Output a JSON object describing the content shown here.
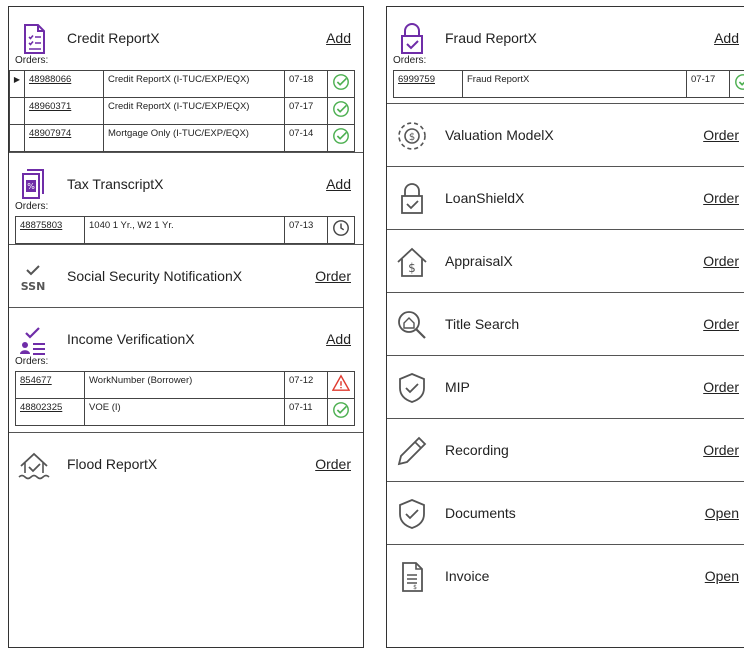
{
  "left": {
    "credit": {
      "title": "Credit ReportX",
      "action": "Add",
      "icon": "credit-report-icon",
      "orders_label": "Orders:",
      "orders": [
        {
          "id": "48988066",
          "desc": "Credit ReportX (I-TUC/EXP/EQX)",
          "date": "07-18",
          "status": "complete-check-icon",
          "selected": true
        },
        {
          "id": "48960371",
          "desc": "Credit ReportX (I-TUC/EXP/EQX)",
          "date": "07-17",
          "status": "complete-check-icon",
          "selected": false
        },
        {
          "id": "48907974",
          "desc": "Mortgage Only (I-TUC/EXP/EQX)",
          "date": "07-14",
          "status": "complete-check-icon",
          "selected": false
        }
      ]
    },
    "tax": {
      "title": "Tax TranscriptX",
      "action": "Add",
      "icon": "tax-transcript-icon",
      "orders_label": "Orders:",
      "orders": [
        {
          "id": "48875803",
          "desc": "1040 1 Yr., W2 1 Yr.",
          "date": "07-13",
          "status": "pending-clock-icon"
        }
      ]
    },
    "ssn": {
      "title": "Social Security NotificationX",
      "action": "Order",
      "icon_text": "SSN"
    },
    "income": {
      "title": "Income VerificationX",
      "action": "Add",
      "icon": "income-verification-icon",
      "orders_label": "Orders:",
      "orders": [
        {
          "id": "854677",
          "desc": "WorkNumber (Borrower)",
          "date": "07-12",
          "status": "warning-icon"
        },
        {
          "id": "48802325",
          "desc": "VOE (I)",
          "date": "07-11",
          "status": "complete-check-icon"
        }
      ]
    },
    "flood": {
      "title": "Flood ReportX",
      "action": "Order",
      "icon": "flood-report-icon"
    }
  },
  "right": {
    "fraud": {
      "title": "Fraud ReportX",
      "action": "Add",
      "icon": "fraud-report-icon",
      "orders_label": "Orders:",
      "orders": [
        {
          "id": "6999759",
          "desc": "Fraud ReportX",
          "date": "07-17",
          "status": "complete-check-icon"
        }
      ]
    },
    "valuation": {
      "title": "Valuation ModelX",
      "action": "Order",
      "icon": "valuation-model-icon"
    },
    "loanshield": {
      "title": "LoanShieldX",
      "action": "Order",
      "icon": "loanshield-icon"
    },
    "appraisal": {
      "title": "AppraisalX",
      "action": "Order",
      "icon": "appraisal-icon",
      "icon_text": "$"
    },
    "title": {
      "title": "Title Search",
      "action": "Order",
      "icon": "title-search-icon"
    },
    "mip": {
      "title": "MIP",
      "action": "Order",
      "icon": "shield-check-icon"
    },
    "recording": {
      "title": "Recording",
      "action": "Order",
      "icon": "pencil-icon"
    },
    "documents": {
      "title": "Documents",
      "action": "Open",
      "icon": "shield-check-icon"
    },
    "invoice": {
      "title": "Invoice",
      "action": "Open",
      "icon": "invoice-icon"
    }
  },
  "colors": {
    "accent": "#6f2da8",
    "success": "#4caf50",
    "warning": "#e03a2f",
    "icon_gray": "#444444"
  }
}
